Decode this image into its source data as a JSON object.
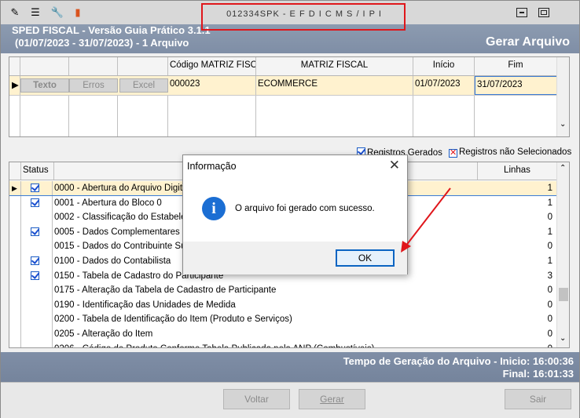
{
  "window": {
    "title": "012334SPK - E F D  I C M S / I P I",
    "toolbar_icons": [
      "edit-icon",
      "list-icon",
      "wrench-icon",
      "book-icon"
    ]
  },
  "header": {
    "line1": "SPED FISCAL - Versão Guia Prático 3.1.1",
    "line2": "(01/07/2023 - 31/07/2023) - 1 Arquivo",
    "action": "Gerar Arquivo"
  },
  "files_grid": {
    "columns": [
      "Código MATRIZ FISCAL",
      "MATRIZ FISCAL",
      "Início",
      "Fim"
    ],
    "row_buttons": [
      "Texto",
      "Erros",
      "Excel"
    ],
    "rows": [
      {
        "codigo": "000023",
        "matriz": "ECOMMERCE",
        "inicio": "01/07/2023",
        "fim": "31/07/2023"
      }
    ]
  },
  "legend": {
    "generated": "Registros Gerados",
    "not_selected": "Registros não Selecionados"
  },
  "records_grid": {
    "col_status": "Status",
    "col_lines": "Linhas",
    "rows": [
      {
        "desc": "0000 - Abertura do Arquivo Digital",
        "lines": "1",
        "checked": true
      },
      {
        "desc": "0001 - Abertura do Bloco 0",
        "lines": "1",
        "checked": true
      },
      {
        "desc": "0002 - Classificação do Estabelecimento",
        "lines": "0",
        "checked": false
      },
      {
        "desc": "0005 - Dados Complementares da Entidade",
        "lines": "1",
        "checked": true
      },
      {
        "desc": "0015 - Dados do Contribuinte Substituto",
        "lines": "0",
        "checked": false
      },
      {
        "desc": "0100 - Dados do Contabilista",
        "lines": "1",
        "checked": true
      },
      {
        "desc": "0150 - Tabela de Cadastro do Participante",
        "lines": "3",
        "checked": true
      },
      {
        "desc": "0175 - Alteração da Tabela de Cadastro de Participante",
        "lines": "0",
        "checked": false
      },
      {
        "desc": "0190 - Identificação das Unidades de Medida",
        "lines": "0",
        "checked": false
      },
      {
        "desc": "0200 - Tabela de Identificação do Item (Produto e Serviços)",
        "lines": "0",
        "checked": false
      },
      {
        "desc": "0205 - Alteração do Item",
        "lines": "0",
        "checked": false
      },
      {
        "desc": "0206 - Código de Produto Conforme Tabela Publicada pela ANP (Combustíveis)",
        "lines": "0",
        "checked": false
      }
    ]
  },
  "status": {
    "line1": "Tempo de Geração do Arquivo - Inicio: 16:00:36",
    "line2": "Final: 16:01:33"
  },
  "buttons": {
    "voltar": "Voltar",
    "gerar": "Gerar",
    "sair": "Sair"
  },
  "dialog": {
    "title": "Informação",
    "message": "O arquivo  foi gerado com sucesso.",
    "ok": "OK"
  }
}
